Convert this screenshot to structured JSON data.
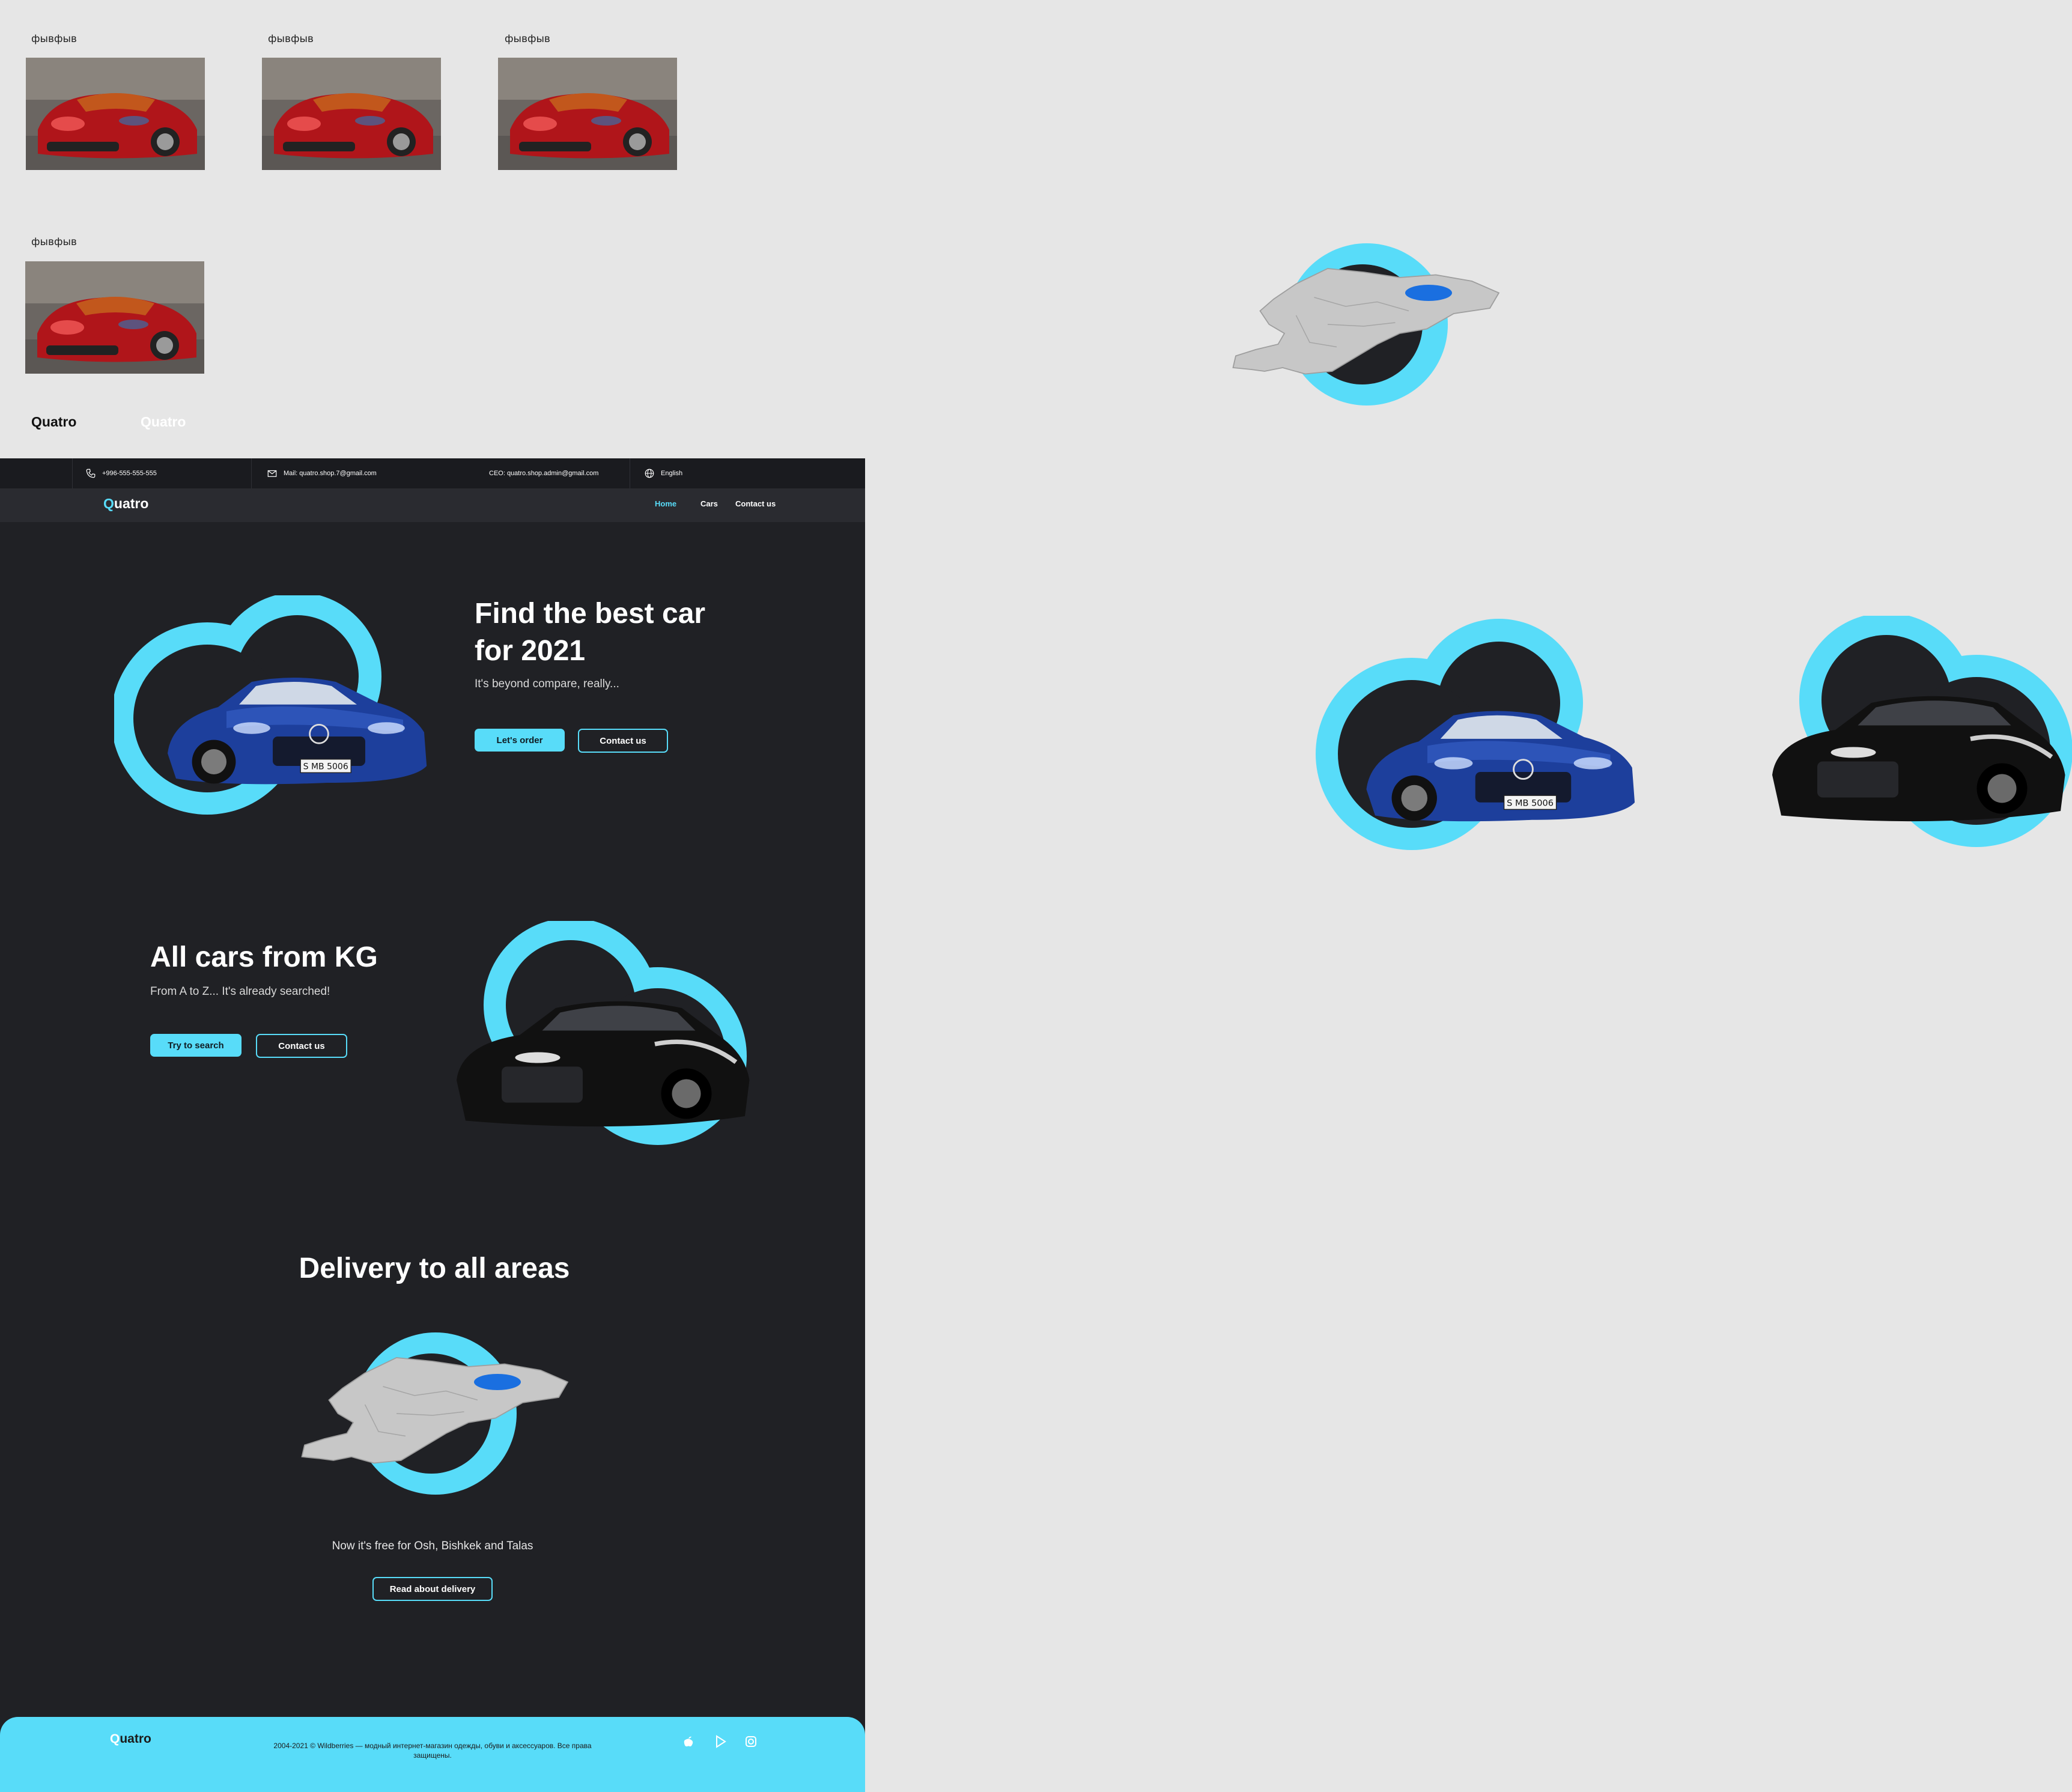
{
  "cards": [
    {
      "label": "фывфыв"
    },
    {
      "label": "фывфыв"
    },
    {
      "label": "фывфыв"
    },
    {
      "label": "фывфыв"
    }
  ],
  "logos": {
    "dark": "Quatro",
    "light": "Quatro"
  },
  "topbar": {
    "phone": "+996-555-555-555",
    "mail": "Mail: quatro.shop.7@gmail.com",
    "ceo": "CEO: quatro.shop.admin@gmail.com",
    "language": "English"
  },
  "nav": {
    "brand_q": "Q",
    "brand_rest": "uatro",
    "links": [
      "Home",
      "Cars",
      "Contact us"
    ]
  },
  "hero": {
    "title_line1": "Find the best car",
    "title_line2": "for 2021",
    "subtitle": "It's beyond compare, really...",
    "primary": "Let's order",
    "secondary": "Contact us"
  },
  "section2": {
    "title": "All cars from KG",
    "subtitle": "From A to Z... It's already searched!",
    "primary": "Try to search",
    "secondary": "Contact us"
  },
  "delivery": {
    "title": "Delivery to all areas",
    "text": "Now it's free for Osh, Bishkek and Talas",
    "button": "Read about delivery"
  },
  "footer": {
    "brand_q": "Q",
    "brand_rest": "uatro",
    "copyright": "2004-2021 © Wildberries — модный интернет-магазин одежды, обуви и аксессуаров. Все права защищены."
  },
  "colors": {
    "accent": "#58dcf9",
    "page_bg": "#202125",
    "canvas_bg": "#e6e6e6",
    "lake": "#1a6fe0"
  },
  "license_plate": "S MB 5006"
}
